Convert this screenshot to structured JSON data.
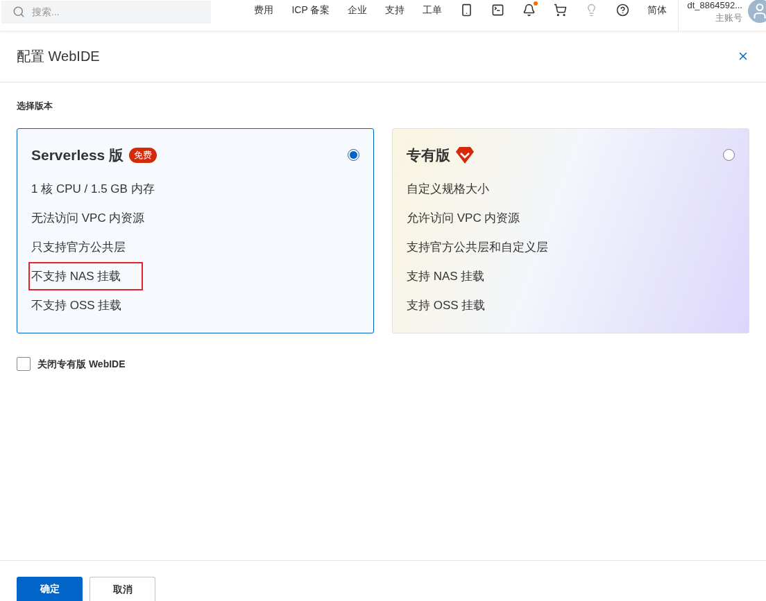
{
  "topbar": {
    "search": {
      "placeholder": "搜索..."
    },
    "nav": [
      "费用",
      "ICP 备案",
      "企业",
      "支持",
      "工单"
    ],
    "icons": [
      {
        "kind": "api",
        "badge": false,
        "disabled": false
      },
      {
        "kind": "terminal",
        "badge": false,
        "disabled": false
      },
      {
        "kind": "bell",
        "badge": true,
        "disabled": false
      },
      {
        "kind": "cart",
        "badge": false,
        "disabled": false
      },
      {
        "kind": "bulb",
        "badge": false,
        "disabled": true
      },
      {
        "kind": "help",
        "badge": false,
        "disabled": false
      }
    ],
    "language": "简体",
    "user": {
      "name": "dt_8864592...",
      "role": "主账号"
    }
  },
  "dialog": {
    "title": "配置 WebIDE",
    "section_label": "选择版本",
    "plans": [
      {
        "kind": "serverless",
        "name": "Serverless 版",
        "badge": "免费",
        "selected": true,
        "features": [
          {
            "text": "1 核 CPU / 1.5 GB 内存",
            "highlighted": false
          },
          {
            "text": "无法访问 VPC 内资源",
            "highlighted": false
          },
          {
            "text": "只支持官方公共层",
            "highlighted": false
          },
          {
            "text": "不支持 NAS 挂载",
            "highlighted": true
          },
          {
            "text": "不支持 OSS 挂载",
            "highlighted": false
          }
        ]
      },
      {
        "kind": "dedicated",
        "name": "专有版",
        "selected": false,
        "features": [
          {
            "text": "自定义规格大小",
            "highlighted": false
          },
          {
            "text": "允许访问 VPC 内资源",
            "highlighted": false
          },
          {
            "text": "支持官方公共层和自定义层",
            "highlighted": false
          },
          {
            "text": "支持 NAS 挂载",
            "highlighted": false
          },
          {
            "text": "支持 OSS 挂载",
            "highlighted": false
          }
        ]
      }
    ],
    "close_checkbox": {
      "label": "关闭专有版 WebIDE",
      "checked": false
    },
    "buttons": [
      {
        "label": "确定",
        "kind": "primary"
      },
      {
        "label": "取消",
        "kind": "secondary"
      }
    ]
  }
}
